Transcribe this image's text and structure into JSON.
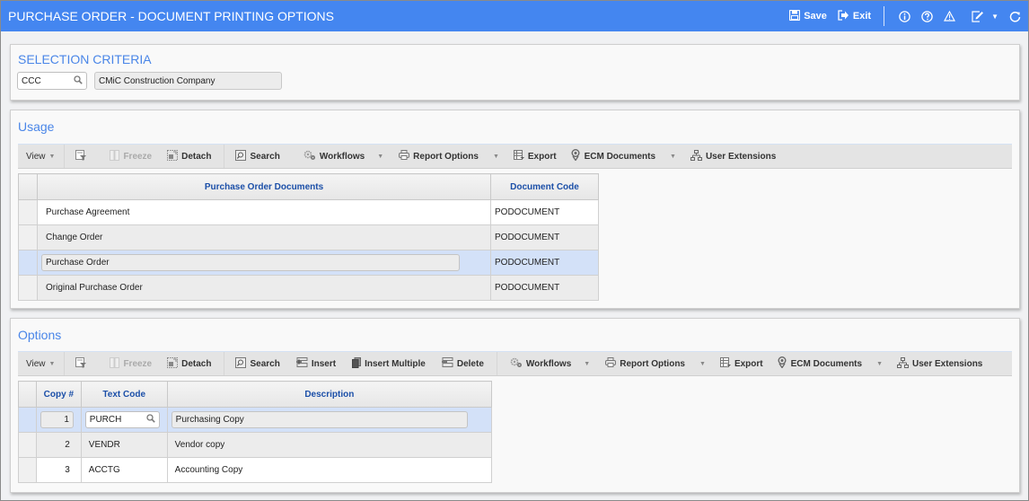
{
  "window": {
    "title": "PURCHASE ORDER - DOCUMENT PRINTING OPTIONS",
    "actions": {
      "save_label": "Save",
      "exit_label": "Exit",
      "icons": [
        "info-icon",
        "help-icon",
        "warning-icon",
        "edit-icon",
        "refresh-icon"
      ]
    }
  },
  "selection_criteria": {
    "title": "SELECTION CRITERIA",
    "company_code": "CCC",
    "company_name": "CMiC Construction Company"
  },
  "usage": {
    "title": "Usage",
    "toolbar": {
      "view": "View",
      "freeze": "Freeze",
      "detach": "Detach",
      "search": "Search",
      "workflows": "Workflows",
      "report_options": "Report Options",
      "export": "Export",
      "ecm_documents": "ECM Documents",
      "user_extensions": "User Extensions"
    },
    "columns": [
      "Purchase Order Documents",
      "Document Code"
    ],
    "rows": [
      {
        "document": "Purchase Agreement",
        "code": "PODOCUMENT"
      },
      {
        "document": "Change Order",
        "code": "PODOCUMENT"
      },
      {
        "document": "Purchase Order",
        "code": "PODOCUMENT",
        "selected": true
      },
      {
        "document": "Original Purchase Order",
        "code": "PODOCUMENT"
      }
    ]
  },
  "options": {
    "title": "Options",
    "toolbar": {
      "view": "View",
      "freeze": "Freeze",
      "detach": "Detach",
      "search": "Search",
      "insert": "Insert",
      "insert_multiple": "Insert Multiple",
      "delete": "Delete",
      "workflows": "Workflows",
      "report_options": "Report Options",
      "export": "Export",
      "ecm_documents": "ECM Documents",
      "user_extensions": "User Extensions"
    },
    "columns": [
      "Copy #",
      "Text Code",
      "Description"
    ],
    "rows": [
      {
        "copy": "1",
        "text_code": "PURCH",
        "description": "Purchasing Copy",
        "selected": true
      },
      {
        "copy": "2",
        "text_code": "VENDR",
        "description": "Vendor copy"
      },
      {
        "copy": "3",
        "text_code": "ACCTG",
        "description": "Accounting Copy"
      }
    ]
  }
}
